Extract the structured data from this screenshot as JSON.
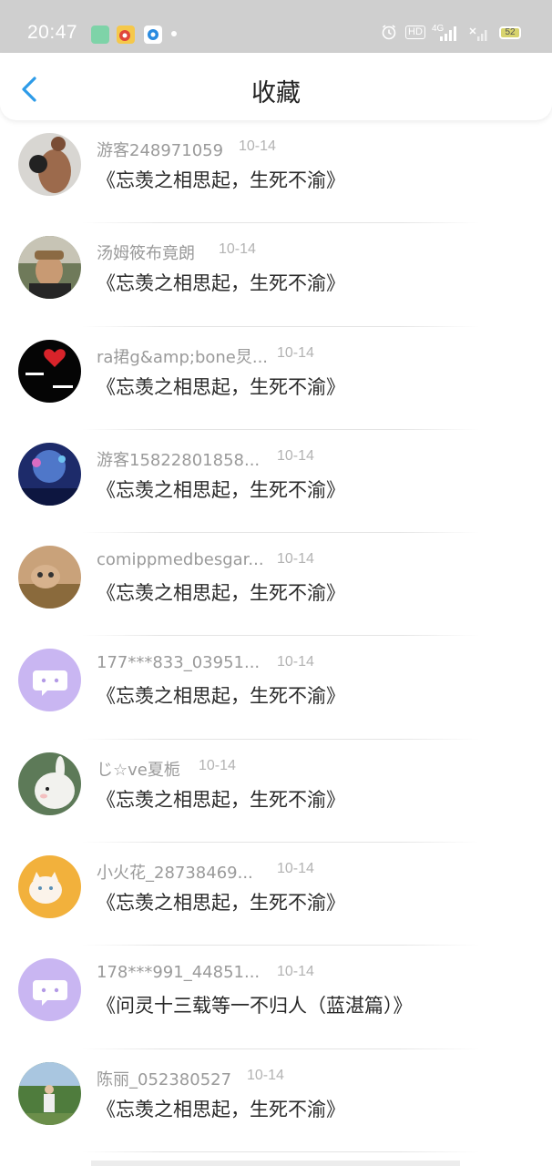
{
  "status_bar": {
    "time": "20:47",
    "network": "4G",
    "hd": "HD",
    "battery": "52"
  },
  "header": {
    "title": "收藏"
  },
  "items": [
    {
      "name": "游客248971059",
      "date": "10-14",
      "title": "《忘羡之相思起，生死不渝》"
    },
    {
      "name": "汤姆筱布竟朗",
      "date": "10-14",
      "title": "《忘羡之相思起，生死不渝》"
    },
    {
      "name": "ra捃g&amp;bone炅...",
      "date": "10-14",
      "title": "《忘羡之相思起，生死不渝》"
    },
    {
      "name": "游客15822801858...",
      "date": "10-14",
      "title": "《忘羡之相思起，生死不渝》"
    },
    {
      "name": "comippmedbesgar...",
      "date": "10-14",
      "title": "《忘羡之相思起，生死不渝》"
    },
    {
      "name": "177***833_03951...",
      "date": "10-14",
      "title": "《忘羡之相思起，生死不渝》"
    },
    {
      "name": "じ☆ve夏栀",
      "date": "10-14",
      "title": "《忘羡之相思起，生死不渝》"
    },
    {
      "name": "小火花_28738469...",
      "date": "10-14",
      "title": "《忘羡之相思起，生死不渝》"
    },
    {
      "name": "178***991_44851...",
      "date": "10-14",
      "title": "《问灵十三载等一不归人（蓝湛篇）》"
    },
    {
      "name": "陈丽_052380527",
      "date": "10-14",
      "title": "《忘羡之相思起，生死不渝》"
    }
  ],
  "colors": {
    "accent": "#2d9be8",
    "status_bar_bg": "#cfcfcf",
    "default_avatar_bg": "#c9b6f2"
  }
}
